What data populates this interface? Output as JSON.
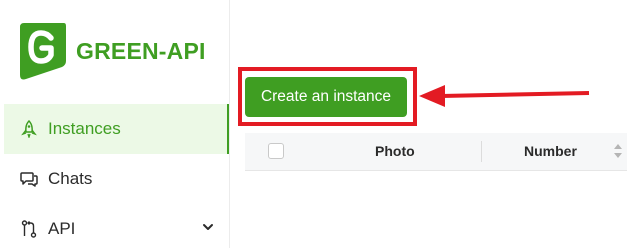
{
  "brand": {
    "name": "GREEN-API",
    "color": "#3f9e22"
  },
  "sidebar": {
    "items": [
      {
        "label": "Instances",
        "icon": "rocket-icon",
        "active": true
      },
      {
        "label": "Chats",
        "icon": "chat-bubbles-icon",
        "active": false
      },
      {
        "label": "API",
        "icon": "api-branch-icon",
        "active": false,
        "expandable": true
      }
    ]
  },
  "main": {
    "create_button": "Create an instance",
    "table": {
      "columns": [
        "Photo",
        "Number"
      ]
    }
  },
  "annotation": {
    "color": "#e31b23"
  }
}
